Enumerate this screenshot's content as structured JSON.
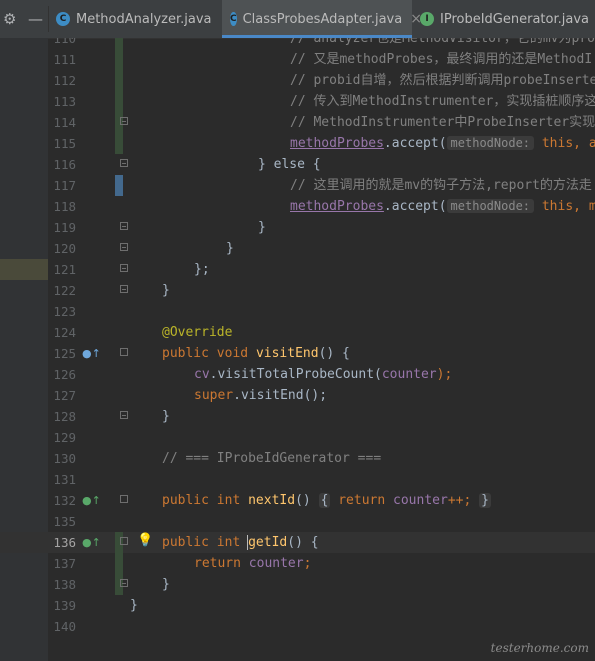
{
  "tabbar": {
    "settings_icon": "gear-icon",
    "minimize_icon": "minus-icon",
    "tabs": [
      {
        "label": "MethodAnalyzer.java",
        "icon": "class-icon",
        "icon_letter": "C",
        "active": false
      },
      {
        "label": "ClassProbesAdapter.java",
        "icon": "class-icon",
        "icon_letter": "C",
        "active": true,
        "close": "×"
      },
      {
        "label": "IProbeIdGenerator.java",
        "icon": "interface-icon",
        "icon_letter": "I",
        "active": false
      }
    ]
  },
  "editor": {
    "current_line": "136",
    "lines": [
      {
        "n": "110",
        "text": "// analyzer也是MethodVisitor，它的mv为pro"
      },
      {
        "n": "111",
        "text": "// 又是methodProbes，最终调用的还是MethodI"
      },
      {
        "n": "112",
        "text": "// probid自增，然后根据判断调用probeInserte"
      },
      {
        "n": "113",
        "text": "// 传入到MethodInstrumenter，实现插桩顺序这"
      },
      {
        "n": "114",
        "text": "// MethodInstrumenter中ProbeInserter实现"
      },
      {
        "n": "115",
        "field": "methodProbes",
        "call": ".accept(",
        "hint": "methodNode:",
        "rest": " this, a"
      },
      {
        "n": "116",
        "text": "} else {"
      },
      {
        "n": "117",
        "text": "// 这里调用的就是mv的钩子方法,report的方法走"
      },
      {
        "n": "118",
        "field": "methodProbes",
        "call": ".accept(",
        "hint": "methodNode:",
        "rest": " this, m"
      },
      {
        "n": "119",
        "text": "}"
      },
      {
        "n": "120",
        "text": "}"
      },
      {
        "n": "121",
        "text": "};"
      },
      {
        "n": "122",
        "text": "}"
      },
      {
        "n": "123",
        "text": ""
      },
      {
        "n": "124",
        "text": "@Override"
      },
      {
        "n": "125",
        "kw1": "public",
        "kw2": "void",
        "name": "visitEnd",
        "rest": "() {"
      },
      {
        "n": "126",
        "obj": "cv",
        "method": ".visitTotalProbeCount(",
        "arg": "counter",
        "end": ");"
      },
      {
        "n": "127",
        "kw": "super",
        "rest": ".visitEnd();"
      },
      {
        "n": "128",
        "text": "}"
      },
      {
        "n": "129",
        "text": ""
      },
      {
        "n": "130",
        "text": "// === IProbeIdGenerator ==="
      },
      {
        "n": "131",
        "text": ""
      },
      {
        "n": "132",
        "kw1": "public",
        "kw2": "int",
        "name": "nextId",
        "rest": "()",
        "body_kw": "return",
        "body_field": "counter",
        "body_end": "++;",
        "brace_open": "{",
        "brace_close": "}"
      },
      {
        "n": "133",
        "text": ""
      },
      {
        "n": "134",
        "text": ""
      },
      {
        "n": "135",
        "text": ""
      },
      {
        "n": "136",
        "kw1": "public",
        "kw2": "int",
        "name": "getId",
        "rest": "() {"
      },
      {
        "n": "137",
        "kw": "return",
        "field": "counter",
        "end": ";"
      },
      {
        "n": "138",
        "text": "}"
      },
      {
        "n": "139",
        "text": "}"
      },
      {
        "n": "140",
        "text": ""
      }
    ]
  },
  "watermark": "testerhome.com",
  "colors": {
    "background": "#2b2b2b",
    "keyword": "#cc7832",
    "method": "#ffc66d",
    "field": "#9876aa",
    "comment": "#808080",
    "annotation": "#bbb529"
  }
}
